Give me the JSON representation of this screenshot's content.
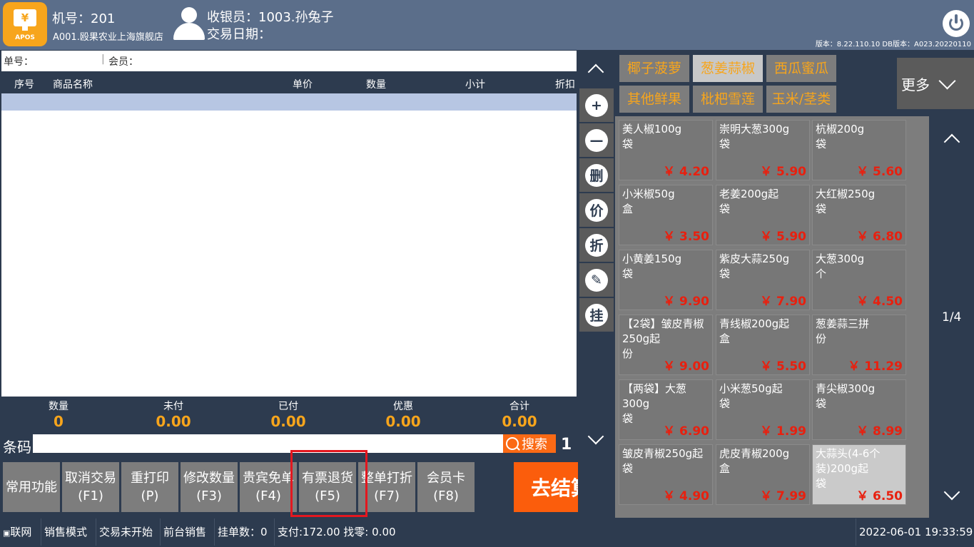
{
  "header": {
    "logo_text": "APOS",
    "logo_symbol": "¥",
    "machine_label": "机号：",
    "machine_no": "201",
    "store": "A001.殴果农业上海旗舰店",
    "cashier_label": "收银员：",
    "cashier": "1003.孙兔子",
    "date_label": "交易日期：",
    "version": "版本：8.22.110.10 DB版本：A023.20220110"
  },
  "ticket": {
    "order_label": "单号：",
    "member_label": "会员："
  },
  "table": {
    "columns": [
      "序号",
      "商品名称",
      "单价",
      "数量",
      "小计",
      "折扣"
    ]
  },
  "summary": [
    {
      "label": "数量",
      "value": "0"
    },
    {
      "label": "未付",
      "value": "0.00"
    },
    {
      "label": "已付",
      "value": "0.00"
    },
    {
      "label": "优惠",
      "value": "0.00"
    },
    {
      "label": "合计",
      "value": "0.00"
    }
  ],
  "barcode": {
    "label": "条码",
    "search_label": "搜索",
    "count": "1"
  },
  "function_buttons": [
    {
      "label": "常用功能",
      "key": ""
    },
    {
      "label": "取消交易",
      "key": "(F1)"
    },
    {
      "label": "重打印",
      "key": "(P)"
    },
    {
      "label": "修改数量",
      "key": "(F3)"
    },
    {
      "label": "贵宾免单",
      "key": "(F4)"
    },
    {
      "label": "有票退货",
      "key": "(F5)"
    },
    {
      "label": "整单打折",
      "key": "(F7)"
    },
    {
      "label": "会员卡",
      "key": "(F8)"
    }
  ],
  "checkout_label": "去结算",
  "side_buttons": [
    "+",
    "—",
    "删",
    "价",
    "折",
    "✎",
    "挂"
  ],
  "categories": [
    {
      "label": "椰子菠萝",
      "selected": false
    },
    {
      "label": "葱姜蒜椒",
      "selected": true
    },
    {
      "label": "西瓜蜜瓜",
      "selected": false
    },
    {
      "label": "其他鲜果",
      "selected": false
    },
    {
      "label": "枇杷雪莲",
      "selected": false
    },
    {
      "label": "玉米/茎类",
      "selected": false
    }
  ],
  "more_label": "更多",
  "products": [
    {
      "name": "美人椒100g",
      "unit": "袋",
      "price": "￥ 4.20"
    },
    {
      "name": "崇明大葱300g",
      "unit": "袋",
      "price": "￥ 5.90"
    },
    {
      "name": "杭椒200g",
      "unit": "袋",
      "price": "￥ 5.60"
    },
    {
      "name": "小米椒50g",
      "unit": "盒",
      "price": "￥ 3.50"
    },
    {
      "name": "老姜200g起",
      "unit": "袋",
      "price": "￥ 5.90"
    },
    {
      "name": "大红椒250g",
      "unit": "袋",
      "price": "￥ 6.80"
    },
    {
      "name": "小黄姜150g",
      "unit": "袋",
      "price": "￥ 9.90"
    },
    {
      "name": "紫皮大蒜250g",
      "unit": "袋",
      "price": "￥ 7.90"
    },
    {
      "name": "大葱300g",
      "unit": "个",
      "price": "￥ 4.50"
    },
    {
      "name": "【2袋】皱皮青椒250g起",
      "unit": "份",
      "price": "￥ 9.00"
    },
    {
      "name": "青线椒200g起",
      "unit": "盒",
      "price": "￥ 5.50"
    },
    {
      "name": "葱姜蒜三拼",
      "unit": "份",
      "price": "￥ 11.29"
    },
    {
      "name": "【两袋】大葱300g",
      "unit": "袋",
      "price": "￥ 6.90"
    },
    {
      "name": "小米葱50g起",
      "unit": "袋",
      "price": "￥ 1.99"
    },
    {
      "name": "青尖椒300g",
      "unit": "袋",
      "price": "￥ 8.99"
    },
    {
      "name": "皱皮青椒250g起",
      "unit": "袋",
      "price": "￥ 4.90"
    },
    {
      "name": "虎皮青椒200g",
      "unit": "盒",
      "price": "￥ 7.99"
    },
    {
      "name": "大蒜头(4-6个装)200g起",
      "unit": "袋",
      "price": "￥ 6.50",
      "selected": true
    }
  ],
  "page_indicator": "1/4",
  "status": {
    "network": "联网",
    "mode": "销售模式",
    "trade": "交易未开始",
    "channel": "前台销售",
    "held_label": "挂单数：",
    "held": "0",
    "payment": "支付:172.00 找零: 0.00",
    "datetime": "2022-06-01 19:33:59"
  },
  "colors": {
    "header_bg": "#5b6e8a",
    "panel_bg": "#2d3b4f",
    "accent_orange": "#f7a51c",
    "checkout": "#fb5d0c",
    "price_red": "#e8200f",
    "highlight_box": "#e3171f"
  }
}
